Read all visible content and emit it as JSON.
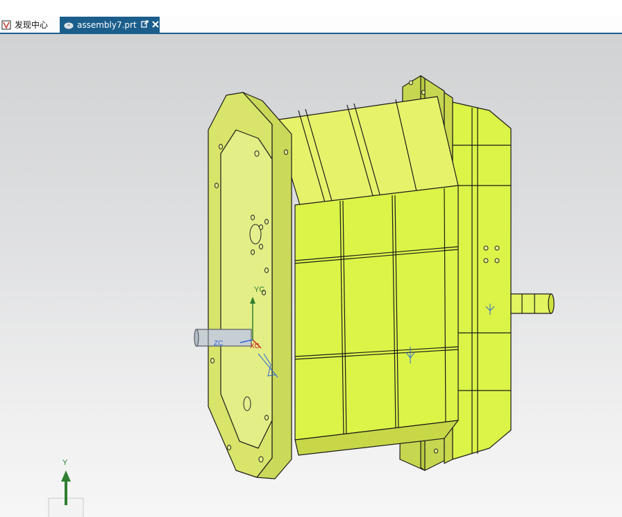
{
  "tabs": [
    {
      "label": "发现中心",
      "icon": "discovery-center-icon",
      "active": false
    },
    {
      "label": "assembly7.prt",
      "icon": "part-file-icon",
      "active": true
    }
  ],
  "tab_tools": {
    "popout_icon": "popout-icon",
    "close_icon": "close-icon"
  },
  "datum_csys": {
    "y_label": "YC",
    "x_label": "XC",
    "z_label": "ZC"
  },
  "view_triad": {
    "y_label": "Y"
  },
  "colors": {
    "tab_active": "#1b5e8c",
    "model_face_light": "#e6f36a",
    "model_face_bright": "#dcf447",
    "model_face_shade": "#c9d848",
    "edge": "#1a1a1a",
    "axis_y": "#2f7e32",
    "axis_x": "#cc2222",
    "constraint_marker": "#2c66d8"
  }
}
